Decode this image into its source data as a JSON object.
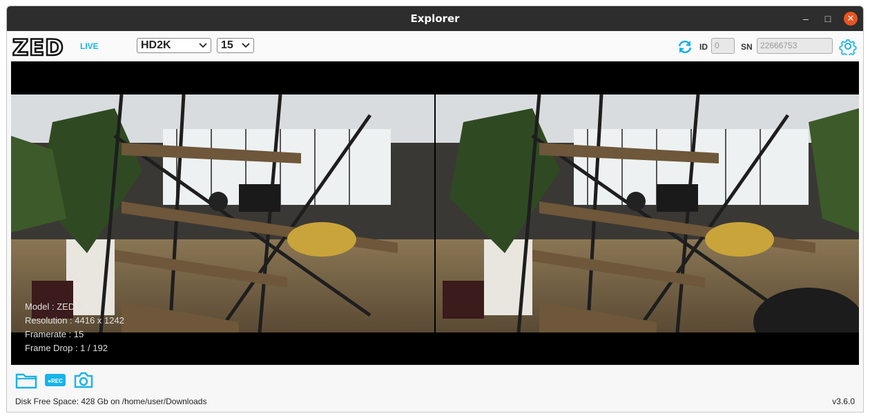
{
  "window": {
    "title": "Explorer"
  },
  "titlebar_buttons": {
    "minimize": "–",
    "maximize": "□",
    "close": "✕"
  },
  "toolbar": {
    "logo_text": "ZED",
    "live_label": "LIVE",
    "resolution_value": "HD2K",
    "framerate_value": "15",
    "id_label": "ID",
    "id_placeholder": "0",
    "sn_label": "SN",
    "sn_placeholder": "22666753"
  },
  "overlay": {
    "model": "Model : ZED 2",
    "resolution": "Resolution : 4416 x 1242",
    "framerate": "Framerate : 15",
    "frame_drop": "Frame Drop : 1 / 192"
  },
  "footer": {
    "rec_label": "●REC",
    "disk_free": "Disk Free Space: 428 Gb  on /home/user/Downloads",
    "version": "v3.6.0"
  },
  "colors": {
    "accent": "#18b3e8",
    "titlebar": "#2d2d2d",
    "close": "#e95420"
  },
  "icons": [
    "refresh-icon",
    "settings-gear-icon",
    "folder-icon",
    "record-icon",
    "camera-icon"
  ]
}
